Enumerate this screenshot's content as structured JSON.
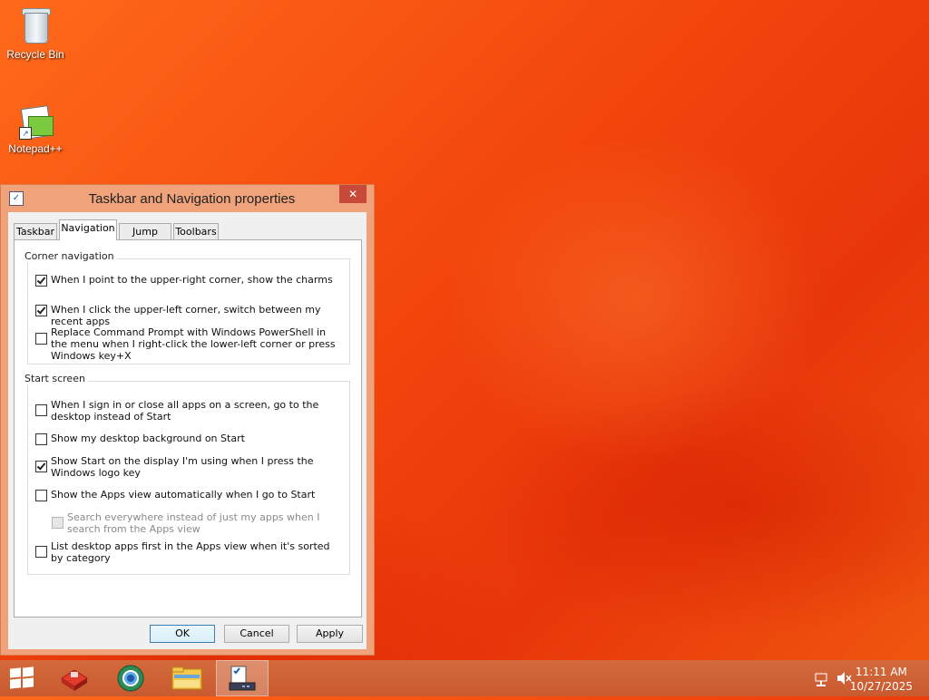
{
  "desktop": {
    "icons": [
      {
        "label": "Recycle Bin",
        "icon": "recycle-bin-icon"
      },
      {
        "label": "Notepad++",
        "icon": "notepad-plus-plus-icon"
      }
    ]
  },
  "dialog": {
    "title": "Taskbar and Navigation properties",
    "close_glyph": "✕",
    "tabs": [
      {
        "label": "Taskbar",
        "active": false
      },
      {
        "label": "Navigation",
        "active": true
      },
      {
        "label": "Jump Lists",
        "active": false
      },
      {
        "label": "Toolbars",
        "active": false
      }
    ],
    "corner_navigation": {
      "label": "Corner navigation",
      "options": [
        {
          "text": "When I point to the upper-right corner, show the charms",
          "checked": true,
          "enabled": true
        },
        {
          "text": "When I click the upper-left corner, switch between my recent apps",
          "checked": true,
          "enabled": true
        },
        {
          "text": "Replace Command Prompt with Windows PowerShell in the menu when I right-click the lower-left corner or press Windows key+X",
          "checked": false,
          "enabled": true
        }
      ]
    },
    "start_screen": {
      "label": "Start screen",
      "options": [
        {
          "text": "When I sign in or close all apps on a screen, go to the desktop instead of Start",
          "checked": false,
          "enabled": true
        },
        {
          "text": "Show my desktop background on Start",
          "checked": false,
          "enabled": true
        },
        {
          "text": "Show Start on the display I'm using when I press the Windows logo key",
          "checked": true,
          "enabled": true
        },
        {
          "text": "Show the Apps view automatically when I go to Start",
          "checked": false,
          "enabled": true
        },
        {
          "text": "Search everywhere instead of just my apps when I search from the Apps view",
          "checked": false,
          "enabled": false
        },
        {
          "text": "List desktop apps first in the Apps view when it's sorted by category",
          "checked": false,
          "enabled": true
        }
      ]
    },
    "buttons": {
      "ok": "OK",
      "cancel": "Cancel",
      "apply": "Apply"
    }
  },
  "taskbar": {
    "items": [
      "start-button",
      "app-1",
      "browser",
      "file-explorer",
      "taskbar-properties"
    ],
    "clock": {
      "time": "11:11 AM",
      "date": "10/27/2025"
    }
  }
}
